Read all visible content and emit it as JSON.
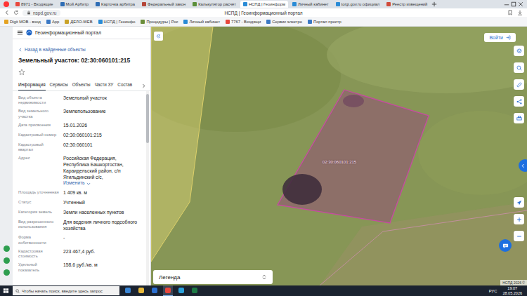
{
  "browser": {
    "tabs": [
      {
        "label": "8971 - Входящие",
        "selected": false,
        "color": "#e8473c"
      },
      {
        "label": "Мой Арбитр",
        "selected": false,
        "color": "#2f6db5"
      },
      {
        "label": "Карточка арбитра",
        "selected": false,
        "color": "#2f6db5"
      },
      {
        "label": "Федеральный закон",
        "selected": false,
        "color": "#b5463a"
      },
      {
        "label": "Калькулятор расчёт",
        "selected": false,
        "color": "#5b8f3a"
      },
      {
        "label": "НСПД | Геоинформ",
        "selected": true,
        "color": "#2a8bd6"
      },
      {
        "label": "Личный кабинет",
        "selected": false,
        "color": "#2a8bd6"
      },
      {
        "label": "torgi.gov.ru официал",
        "selected": false,
        "color": "#2a8bd6"
      },
      {
        "label": "Реестр извещений",
        "selected": false,
        "color": "#d04a3a"
      }
    ],
    "address": "nspd.gov.ru",
    "page_title": "НСПД | Геоинформационный портал",
    "bookmarks": [
      {
        "label": "Digit МОВ - вход",
        "color": "#e4a221"
      },
      {
        "label": "App",
        "color": "#3b78c4"
      },
      {
        "label": "ДЕЛО-WEB",
        "color": "#c9a227"
      },
      {
        "label": "НСПД | Геоинфо",
        "color": "#2a8bd6"
      },
      {
        "label": "Процедуры | Рос",
        "color": "#6b8e3a"
      },
      {
        "label": "Личный кабинет",
        "color": "#2a8bd6"
      },
      {
        "label": "7767 - Входящи",
        "color": "#e8473c"
      },
      {
        "label": "Сервис электро",
        "color": "#3b78c4"
      },
      {
        "label": "Портал простр",
        "color": "#3b78c4"
      }
    ],
    "side_apps": [
      {
        "color": "#2e9e4f"
      },
      {
        "color": "#2e9e4f"
      },
      {
        "color": "#2e9e4f"
      }
    ]
  },
  "portal": {
    "title": "Геоинформационный портал",
    "back": "Назад в найденные объекты",
    "object_title": "Земельный участок: 02:30:060101:215",
    "favorite": false,
    "tabs": [
      {
        "label": "Информация",
        "selected": true
      },
      {
        "label": "Сервисы",
        "selected": false
      },
      {
        "label": "Объекты",
        "selected": false
      },
      {
        "label": "Части ЗУ",
        "selected": false
      },
      {
        "label": "Состав",
        "selected": false
      }
    ],
    "fields": [
      {
        "label": "Вид объекта недвижимости",
        "value": "Земельный участок"
      },
      {
        "label": "Вид земельного участка",
        "value": "Землепользование"
      },
      {
        "label": "Дата присвоения",
        "value": "15.01.2026"
      },
      {
        "label": "Кадастровый номер",
        "value": "02:30:060101:215"
      },
      {
        "label": "Кадастровый квартал",
        "value": "02:30:060101"
      },
      {
        "label": "Адрес",
        "value": "Российская Федерация, Республика Башкортостан, Караидельский район, с/п Ягильдинский с/с,",
        "link": "Изменить"
      },
      {
        "label": "Площадь уточненная",
        "value": "1 409 кв. м"
      },
      {
        "label": "Статус",
        "value": "Учтенный"
      },
      {
        "label": "Категория земель",
        "value": "Земли населенных пунктов"
      },
      {
        "label": "Вид разрешенного использования",
        "value": "Для ведения личного подсобного хозяйства"
      },
      {
        "label": "Форма собственности",
        "value": "-"
      },
      {
        "label": "Кадастровая стоимость",
        "value": "223 467,4 руб."
      },
      {
        "label": "Удельный показатель",
        "value": "158,6 руб./кв. м"
      }
    ]
  },
  "map": {
    "login": "Войти",
    "parcel_label": "02:30:060101:215",
    "legend": "Легенда",
    "copyright": "НСПД 2026 ©"
  },
  "taskbar": {
    "search_placeholder": "Чтобы начать поиск, введите здесь запрос",
    "apps": [
      {
        "color": "#3a86d6",
        "selected": false
      },
      {
        "color": "#e8b93a",
        "selected": false
      },
      {
        "color": "#2b6fd0",
        "selected": false
      },
      {
        "color": "#e8473c",
        "selected": true
      },
      {
        "color": "#2aa1da",
        "selected": false
      },
      {
        "color": "#1d7a45",
        "selected": false
      }
    ],
    "language": "РУС",
    "time": "19:07",
    "date": "28.05.2026"
  }
}
